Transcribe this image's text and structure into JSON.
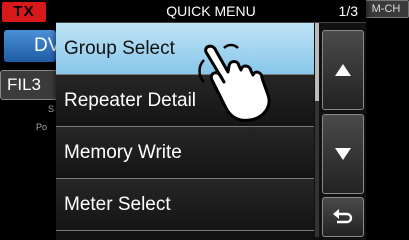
{
  "background": {
    "tx_badge": "TX",
    "mode_button": "DV",
    "filter_button": "FIL3",
    "mini_s": "S",
    "mini_po": "Po",
    "channel_badge": "M-CH"
  },
  "menu": {
    "title": "QUICK MENU",
    "page": "1/3",
    "items": [
      {
        "label": "Group Select",
        "selected": true
      },
      {
        "label": "Repeater Detail",
        "selected": false
      },
      {
        "label": "Memory Write",
        "selected": false
      },
      {
        "label": "Meter Select",
        "selected": false
      }
    ]
  },
  "icons": {
    "up": "triangle-up-icon",
    "down": "triangle-down-icon",
    "back": "return-arrow-icon",
    "pointer": "hand-pointer-icon"
  },
  "colors": {
    "tx": "#d7191c",
    "selected_item": "#a8d8f0",
    "mode_button": "#2f6fbf"
  }
}
